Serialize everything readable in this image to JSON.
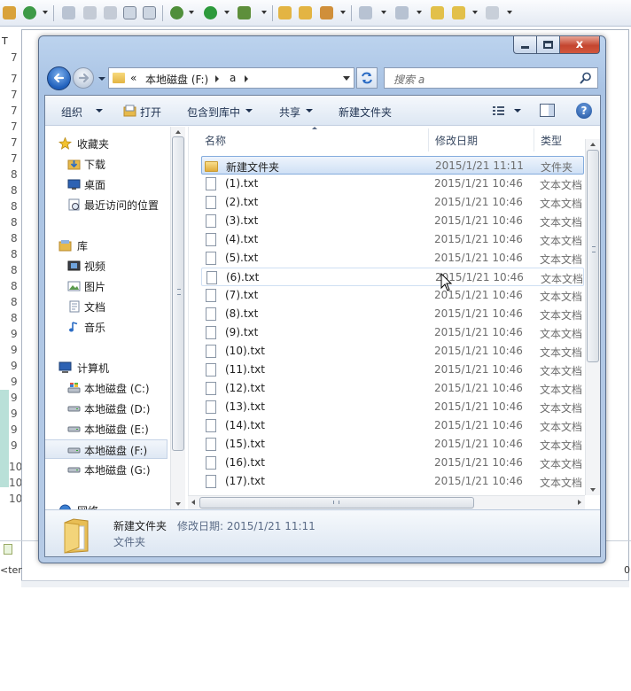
{
  "ide": {
    "tab_letter": "T",
    "gutter_numbers": [
      "7",
      "7",
      "7",
      "7",
      "7",
      "7",
      "7",
      "8",
      "8",
      "8",
      "8",
      "8",
      "8",
      "8",
      "8",
      "8",
      "8",
      "9",
      "9",
      "9",
      "9",
      "9",
      "9",
      "9",
      "9",
      "10",
      "10",
      "10"
    ],
    "bottom_text": "<ter",
    "bottom_right_text": "0"
  },
  "window": {
    "caption_close": "x"
  },
  "address_bar": {
    "overflow": "«",
    "segments": [
      "本地磁盘 (F:)",
      "a"
    ]
  },
  "search": {
    "placeholder": "搜索 a"
  },
  "command_bar": {
    "organize": "组织",
    "open": "打开",
    "include_in_library": "包含到库中",
    "share": "共享",
    "new_folder": "新建文件夹",
    "help": "?"
  },
  "nav_pane": {
    "favorites": "收藏夹",
    "downloads": "下载",
    "desktop": "桌面",
    "recent": "最近访问的位置",
    "libraries": "库",
    "videos": "视频",
    "pictures": "图片",
    "documents": "文档",
    "music": "音乐",
    "computer": "计算机",
    "drives": [
      "本地磁盘 (C:)",
      "本地磁盘 (D:)",
      "本地磁盘 (E:)",
      "本地磁盘 (F:)",
      "本地磁盘 (G:)"
    ],
    "network": "网络"
  },
  "columns": {
    "name": "名称",
    "modified": "修改日期",
    "type": "类型"
  },
  "files": [
    {
      "name": "新建文件夹",
      "date": "2015/1/21 11:11",
      "type": "文件夹",
      "kind": "folder"
    },
    {
      "name": "(1).txt",
      "date": "2015/1/21 10:46",
      "type": "文本文档",
      "kind": "txt"
    },
    {
      "name": "(2).txt",
      "date": "2015/1/21 10:46",
      "type": "文本文档",
      "kind": "txt"
    },
    {
      "name": "(3).txt",
      "date": "2015/1/21 10:46",
      "type": "文本文档",
      "kind": "txt"
    },
    {
      "name": "(4).txt",
      "date": "2015/1/21 10:46",
      "type": "文本文档",
      "kind": "txt"
    },
    {
      "name": "(5).txt",
      "date": "2015/1/21 10:46",
      "type": "文本文档",
      "kind": "txt"
    },
    {
      "name": "(6).txt",
      "date": "2015/1/21 10:46",
      "type": "文本文档",
      "kind": "txt"
    },
    {
      "name": "(7).txt",
      "date": "2015/1/21 10:46",
      "type": "文本文档",
      "kind": "txt"
    },
    {
      "name": "(8).txt",
      "date": "2015/1/21 10:46",
      "type": "文本文档",
      "kind": "txt"
    },
    {
      "name": "(9).txt",
      "date": "2015/1/21 10:46",
      "type": "文本文档",
      "kind": "txt"
    },
    {
      "name": "(10).txt",
      "date": "2015/1/21 10:46",
      "type": "文本文档",
      "kind": "txt"
    },
    {
      "name": "(11).txt",
      "date": "2015/1/21 10:46",
      "type": "文本文档",
      "kind": "txt"
    },
    {
      "name": "(12).txt",
      "date": "2015/1/21 10:46",
      "type": "文本文档",
      "kind": "txt"
    },
    {
      "name": "(13).txt",
      "date": "2015/1/21 10:46",
      "type": "文本文档",
      "kind": "txt"
    },
    {
      "name": "(14).txt",
      "date": "2015/1/21 10:46",
      "type": "文本文档",
      "kind": "txt"
    },
    {
      "name": "(15).txt",
      "date": "2015/1/21 10:46",
      "type": "文本文档",
      "kind": "txt"
    },
    {
      "name": "(16).txt",
      "date": "2015/1/21 10:46",
      "type": "文本文档",
      "kind": "txt"
    },
    {
      "name": "(17).txt",
      "date": "2015/1/21 10:46",
      "type": "文本文档",
      "kind": "txt"
    }
  ],
  "details": {
    "name": "新建文件夹",
    "date_label": "修改日期: 2015/1/21 11:11",
    "type": "文件夹"
  }
}
